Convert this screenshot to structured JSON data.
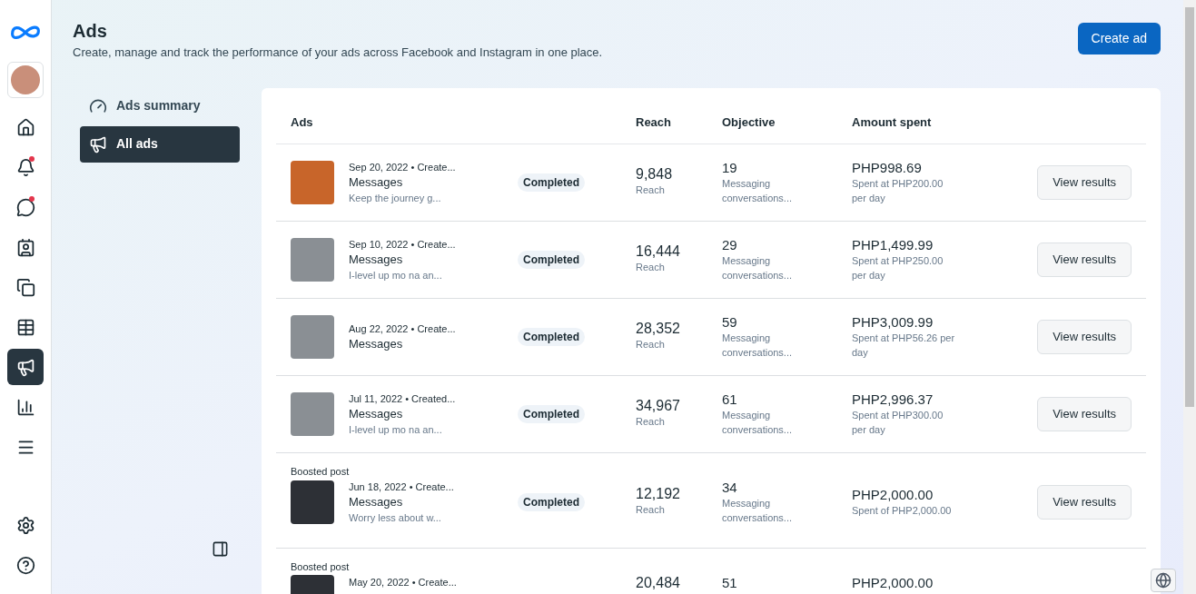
{
  "rail": {
    "items": [
      {
        "kind": "home",
        "selected": false,
        "dot": false
      },
      {
        "kind": "bell",
        "selected": false,
        "dot": true
      },
      {
        "kind": "chat",
        "selected": false,
        "dot": true
      },
      {
        "kind": "contact",
        "selected": false,
        "dot": false
      },
      {
        "kind": "pages",
        "selected": false,
        "dot": false
      },
      {
        "kind": "table",
        "selected": false,
        "dot": false
      },
      {
        "kind": "megaphone",
        "selected": true,
        "dot": false
      },
      {
        "kind": "chart",
        "selected": false,
        "dot": false
      },
      {
        "kind": "menu",
        "selected": false,
        "dot": false
      }
    ],
    "bottom": [
      {
        "kind": "settings"
      },
      {
        "kind": "help"
      }
    ]
  },
  "header": {
    "title": "Ads",
    "subtitle": "Create, manage and track the performance of your ads across Facebook and Instagram in one place.",
    "button": "Create ad"
  },
  "nav": [
    {
      "kind": "gauge",
      "label": "Ads summary",
      "selected": false
    },
    {
      "kind": "megaphone",
      "label": "All ads",
      "selected": true
    }
  ],
  "table": {
    "columns": [
      "Ads",
      "Reach",
      "Objective",
      "Amount spent"
    ],
    "rows": [
      {
        "tag": "",
        "date": "Sep 20, 2022 • Create...",
        "title": "Messages",
        "text": "Keep the journey g...",
        "status": "Completed",
        "reach": "9,848",
        "reach_label": "Reach",
        "objective": "19",
        "objective_label": "Messaging conversations...",
        "amount": "PHP998.69",
        "amount_note": "Spent at PHP200.00 per day",
        "button": "View results"
      },
      {
        "tag": "",
        "date": "Sep 10, 2022 • Create...",
        "title": "Messages",
        "text": "I-level up mo na an...",
        "status": "Completed",
        "reach": "16,444",
        "reach_label": "Reach",
        "objective": "29",
        "objective_label": "Messaging conversations...",
        "amount": "PHP1,499.99",
        "amount_note": "Spent at PHP250.00 per day",
        "button": "View results"
      },
      {
        "tag": "",
        "date": "Aug 22, 2022 • Create...",
        "title": "Messages",
        "text": "",
        "status": "Completed",
        "reach": "28,352",
        "reach_label": "Reach",
        "objective": "59",
        "objective_label": "Messaging conversations...",
        "amount": "PHP3,009.99",
        "amount_note": "Spent at PHP56.26 per day",
        "button": "View results"
      },
      {
        "tag": "",
        "date": "Jul 11, 2022 • Created...",
        "title": "Messages",
        "text": "I-level up mo na an...",
        "status": "Completed",
        "reach": "34,967",
        "reach_label": "Reach",
        "objective": "61",
        "objective_label": "Messaging conversations...",
        "amount": "PHP2,996.37",
        "amount_note": "Spent at PHP300.00 per day",
        "button": "View results"
      },
      {
        "tag": "Boosted post",
        "date": "Jun 18, 2022 • Create...",
        "title": "Messages",
        "text": "Worry less about w...",
        "status": "Completed",
        "reach": "12,192",
        "reach_label": "Reach",
        "objective": "34",
        "objective_label": "Messaging conversations...",
        "amount": "PHP2,000.00",
        "amount_note": "Spent of PHP2,000.00",
        "button": "View results"
      },
      {
        "tag": "Boosted post",
        "date": "May 20, 2022 • Create...",
        "title": "",
        "text": "",
        "status": "",
        "reach": "20,484",
        "reach_label": "",
        "objective": "51",
        "objective_label": "",
        "amount": "PHP2,000.00",
        "amount_note": "",
        "button": ""
      }
    ]
  }
}
